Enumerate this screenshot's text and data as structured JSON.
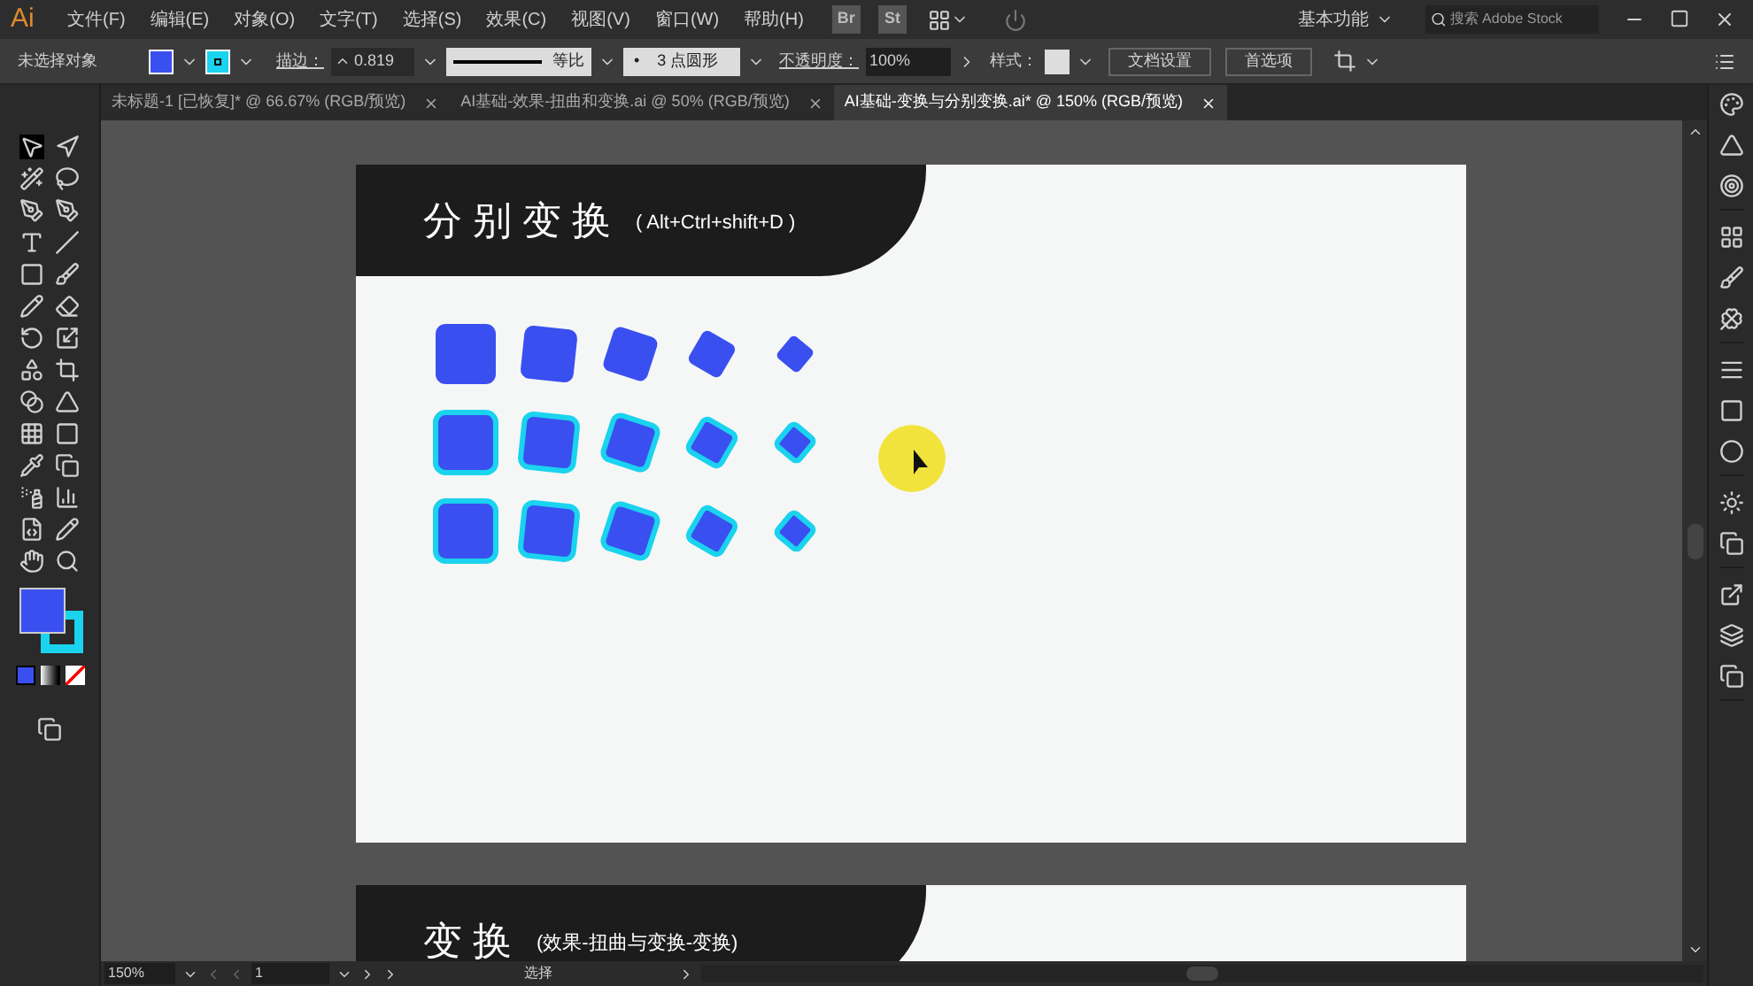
{
  "app_logo": "Ai",
  "menu": [
    "文件(F)",
    "编辑(E)",
    "对象(O)",
    "文字(T)",
    "选择(S)",
    "效果(C)",
    "视图(V)",
    "窗口(W)",
    "帮助(H)"
  ],
  "app_badges": [
    "Br",
    "St"
  ],
  "workspace": "基本功能",
  "search": {
    "placeholder": "搜索 Adobe Stock"
  },
  "control_bar": {
    "selection": "未选择对象",
    "stroke_label": "描边：",
    "stroke_weight": "0.819",
    "stroke_profile": "等比",
    "brush_bullet": "•",
    "brush": "3 点圆形",
    "opacity_label": "不透明度：",
    "opacity": "100%",
    "style_label": "样式：",
    "buttons": [
      "文档设置",
      "首选项"
    ]
  },
  "tabs": [
    {
      "label": "未标题-1 [已恢复]* @ 66.67% (RGB/预览)",
      "selected": false
    },
    {
      "label": "AI基础-效果-扭曲和变换.ai @ 50% (RGB/预览)",
      "selected": false
    },
    {
      "label": "AI基础-变换与分别变换.ai* @ 150% (RGB/预览)",
      "selected": true
    }
  ],
  "artboards": [
    {
      "title": "分别变换",
      "subtitle": "( Alt+Ctrl+shift+D )",
      "square_rows": [
        {
          "outlined": false
        },
        {
          "outlined": true
        },
        {
          "outlined": true
        }
      ]
    },
    {
      "title": "变换",
      "subtitle": "(效果-扭曲与变换-变换)"
    }
  ],
  "status_bar": {
    "zoom": "150%",
    "artboard": "1",
    "tool": "选择"
  }
}
